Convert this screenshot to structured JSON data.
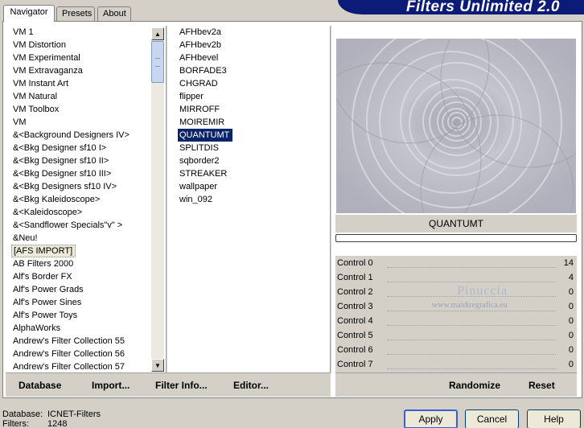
{
  "banner": {
    "title": "Filters Unlimited 2.0"
  },
  "tabs": [
    {
      "label": "Navigator"
    },
    {
      "label": "Presets"
    },
    {
      "label": "About"
    }
  ],
  "categories": [
    "VM 1",
    "VM Distortion",
    "VM Experimental",
    "VM Extravaganza",
    "VM Instant Art",
    "VM Natural",
    "VM Toolbox",
    "VM",
    "&<Background Designers IV>",
    "&<Bkg Designer sf10 I>",
    "&<Bkg Designer sf10 II>",
    "&<Bkg Designer sf10 III>",
    "&<Bkg Designers sf10 IV>",
    "&<Bkg Kaleidoscope>",
    "&<Kaleidoscope>",
    "&<Sandflower Specials\"v\" >",
    "&Neu!",
    "[AFS IMPORT]",
    "AB Filters 2000",
    "Alf's Border FX",
    "Alf's Power Grads",
    "Alf's Power Sines",
    "Alf's Power Toys",
    "AlphaWorks",
    "Andrew's Filter Collection 55",
    "Andrew's Filter Collection 56",
    "Andrew's Filter Collection 57"
  ],
  "selected_category": "[AFS IMPORT]",
  "filters": [
    "AFHbev2a",
    "AFHbev2b",
    "AFHbevel",
    "BORFADE3",
    "CHGRAD",
    "flipper",
    "MIRROFF",
    "MOIREMIR",
    "QUANTUMT",
    "SPLITDIS",
    "sqborder2",
    "STREAKER",
    "wallpaper",
    "win_092"
  ],
  "selected_filter": "QUANTUMT",
  "toolbar": {
    "database": "Database",
    "import": "Import...",
    "filter_info": "Filter Info...",
    "editor": "Editor..."
  },
  "preview": {
    "filter_name": "QUANTUMT"
  },
  "controls": [
    {
      "label": "Control 0",
      "value": "14"
    },
    {
      "label": "Control 1",
      "value": "4"
    },
    {
      "label": "Control 2",
      "value": "0"
    },
    {
      "label": "Control 3",
      "value": "0"
    },
    {
      "label": "Control 4",
      "value": "0"
    },
    {
      "label": "Control 5",
      "value": "0"
    },
    {
      "label": "Control 6",
      "value": "0"
    },
    {
      "label": "Control 7",
      "value": "0"
    }
  ],
  "watermark": {
    "name": "Pinuccia",
    "url": "www.maidiregrafica.eu"
  },
  "actions": {
    "randomize": "Randomize",
    "reset": "Reset"
  },
  "status": {
    "database_label": "Database:",
    "database_value": "ICNET-Filters",
    "filters_label": "Filters:",
    "filters_value": "1248"
  },
  "buttons": {
    "apply": "Apply",
    "cancel": "Cancel",
    "help": "Help"
  },
  "colors": {
    "banner": "#0c1a78",
    "selection": "#0a246a",
    "face": "#d4d0c8"
  }
}
